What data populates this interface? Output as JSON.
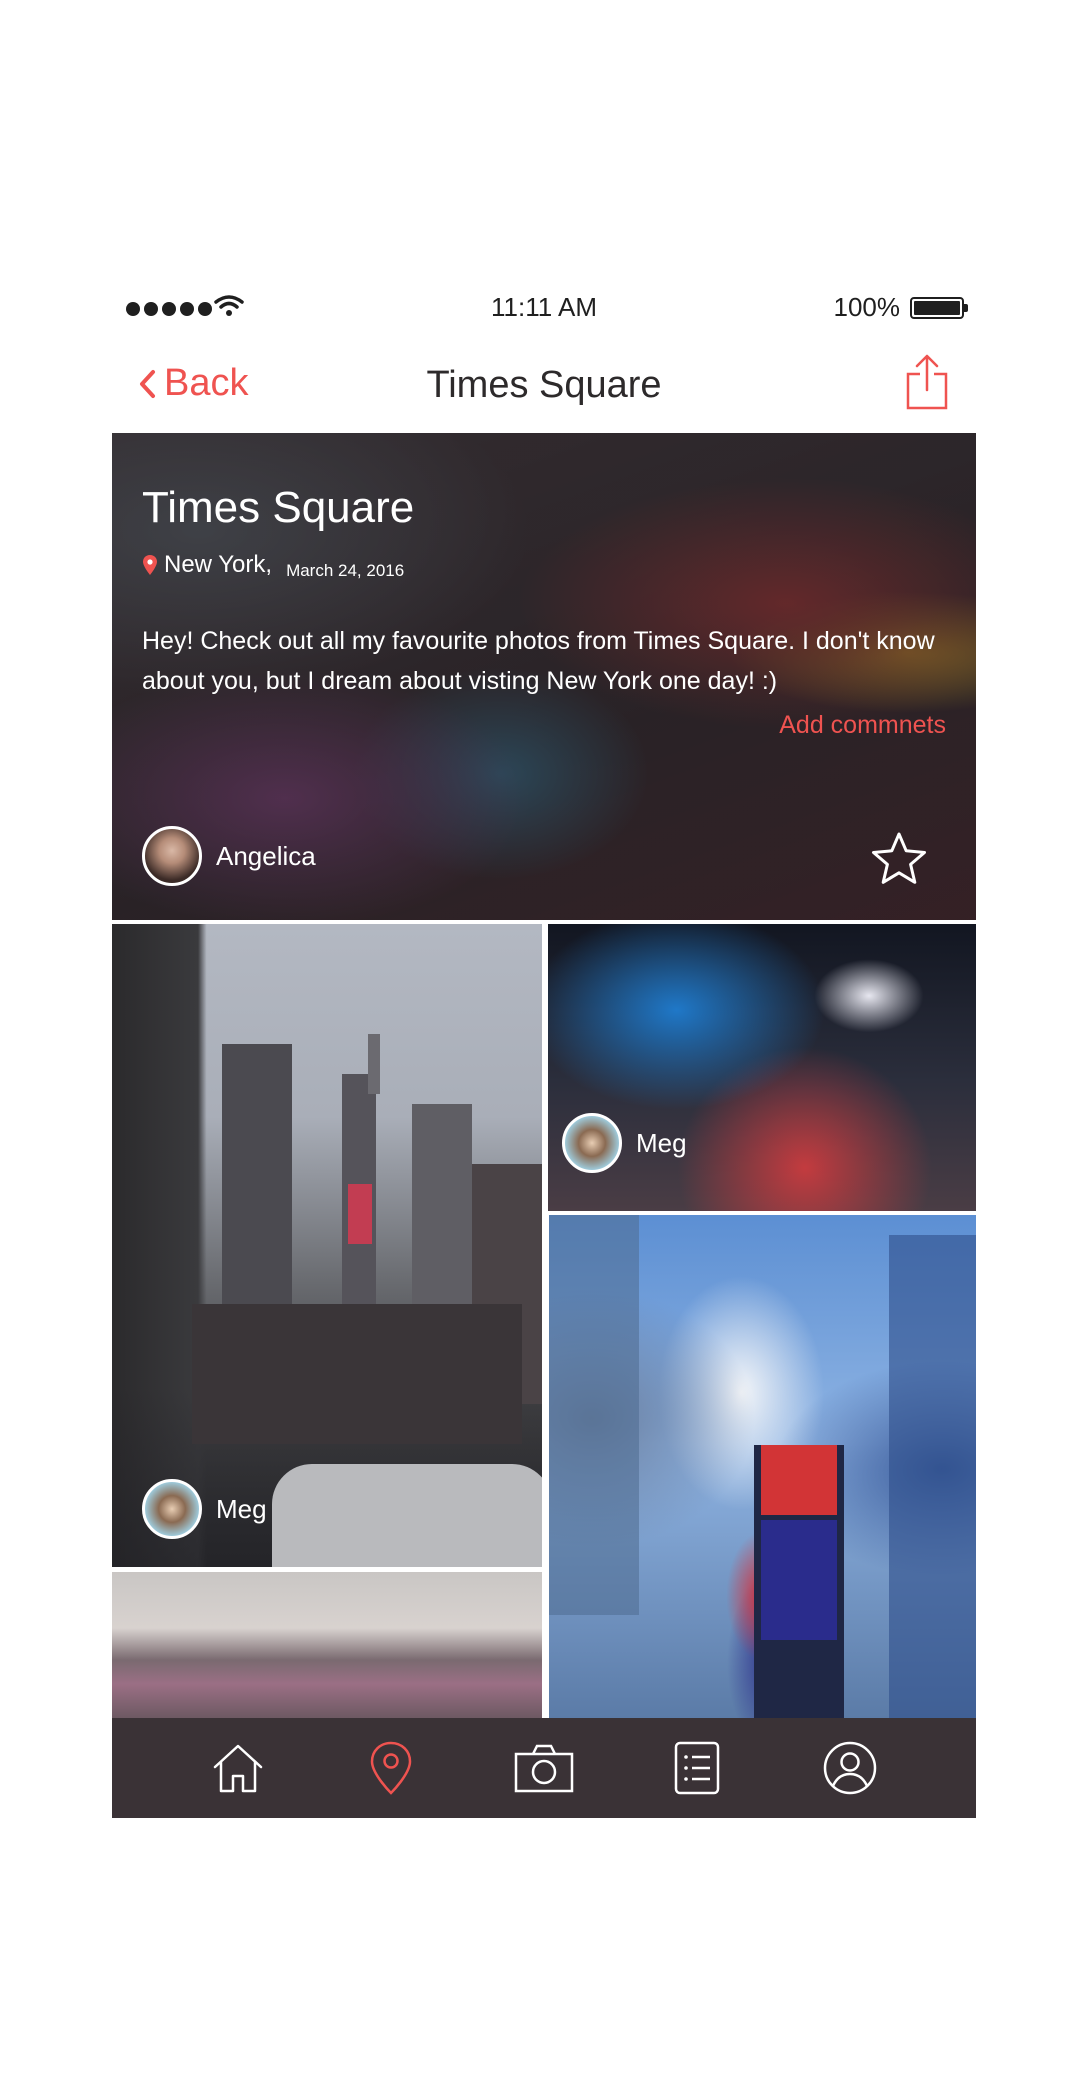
{
  "status_bar": {
    "time": "11:11 AM",
    "battery": "100%",
    "signal_icon": "signal-dots-icon",
    "wifi_icon": "wifi-icon",
    "battery_icon": "battery-icon"
  },
  "nav": {
    "back_label": "Back",
    "title": "Times Square",
    "share_icon": "share-icon"
  },
  "colors": {
    "accent": "#ef5350",
    "tabbar_bg": "#3a3236",
    "text_dark": "#2d2a2b"
  },
  "hero": {
    "title": "Times Square",
    "city": "New York,",
    "date": "March 24, 2016",
    "description": "Hey! Check out all my favourite photos from Times Square. I don't know about you, but I dream about visting New York one day! :)",
    "add_comments": "Add commnets",
    "author": "Angelica",
    "star_icon": "star-icon"
  },
  "photos": [
    {
      "author": "Meg"
    },
    {
      "author": "Meg"
    },
    {
      "author": ""
    },
    {
      "author": ""
    }
  ],
  "tabbar": {
    "items": [
      {
        "icon": "home-icon",
        "active": false
      },
      {
        "icon": "location-pin-icon",
        "active": true
      },
      {
        "icon": "camera-icon",
        "active": false
      },
      {
        "icon": "list-icon",
        "active": false
      },
      {
        "icon": "profile-icon",
        "active": false
      }
    ]
  }
}
